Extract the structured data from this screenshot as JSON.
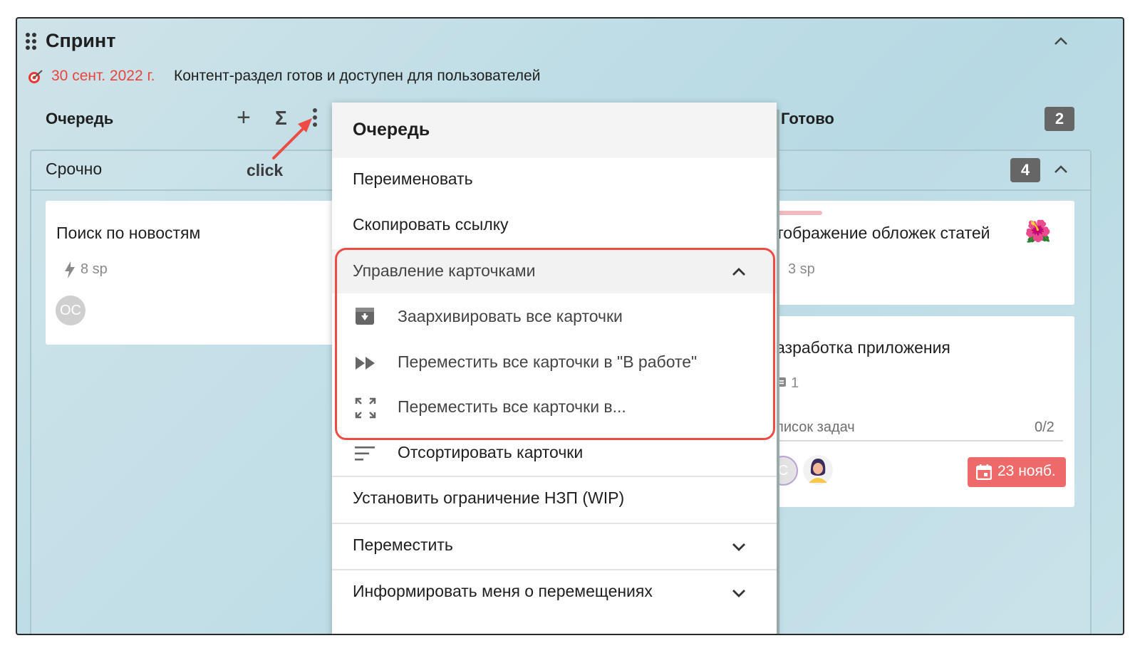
{
  "board": {
    "title": "Спринт",
    "goal": {
      "date": "30 сент. 2022 г.",
      "text": "Контент-раздел готов и доступен для пользователей"
    }
  },
  "columns": {
    "queue": {
      "title": "Очередь",
      "plus": "+",
      "sigma": "Σ"
    },
    "done": {
      "title": "Готово",
      "count": "2"
    }
  },
  "lane": {
    "title": "Срочно",
    "count": "4"
  },
  "annotation": {
    "label": "click",
    "color": "#ee4b45"
  },
  "cards": {
    "left": {
      "title": "Поиск по новостям",
      "points": "8 sp",
      "avatar": "OC"
    },
    "right_top": {
      "title": "тображение обложек статей",
      "points": "3 sp",
      "emoji": "🌺"
    },
    "right_bottom": {
      "title": "азработка приложения",
      "comments": "1",
      "checklist_label": "писок задач",
      "checklist_progress": "0/2",
      "avatar": "C",
      "due": "23 нояб.",
      "due_color": "#ee6a6a"
    }
  },
  "menu": {
    "title": "Очередь",
    "rename": "Переименовать",
    "copy_link": "Скопировать ссылку",
    "manage_group": "Управление карточками",
    "archive_all": "Заархивировать все карточки",
    "move_all_in_work": "Переместить все карточки в \"В работе\"",
    "move_all_to": "Переместить все карточки в...",
    "sort": "Отсортировать карточки",
    "wip_limit": "Установить ограничение НЗП (WIP)",
    "move": "Переместить",
    "notify": "Информировать меня о перемещениях"
  }
}
